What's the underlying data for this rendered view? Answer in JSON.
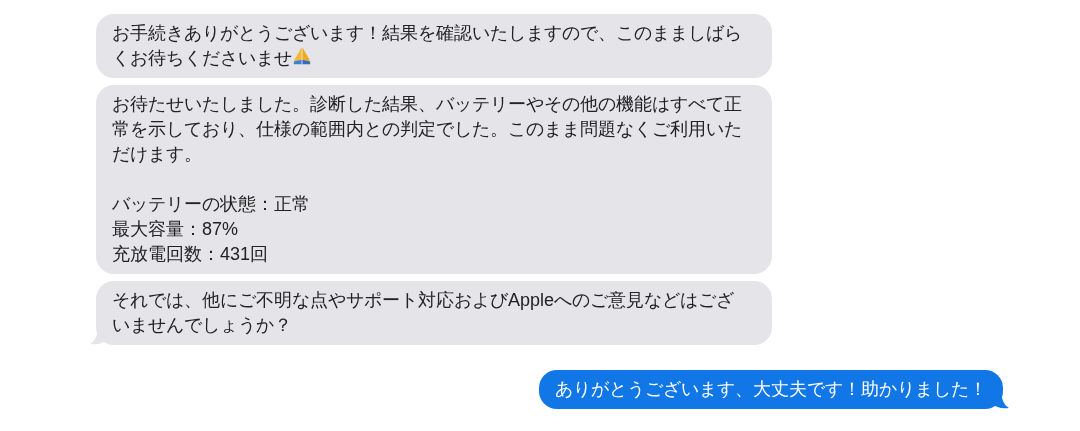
{
  "messages": [
    {
      "kind": "received",
      "tail": false,
      "trailing_icon": true,
      "paragraphs": [
        [
          "お手続きありがとうございます！結果を確認いたしますので、このまましばら",
          "くお待ちくださいませ"
        ]
      ]
    },
    {
      "kind": "received",
      "tail": false,
      "trailing_icon": false,
      "paragraphs": [
        [
          "お待たせいたしました。診断した結果、バッテリーやその他の機能はすべて正",
          "常を示しており、仕様の範囲内との判定でした。このまま問題なくご利用いた",
          "だけます。"
        ],
        [
          "バッテリーの状態：正常",
          "最大容量：87%",
          "充放電回数：431回"
        ]
      ]
    },
    {
      "kind": "received",
      "tail": true,
      "trailing_icon": false,
      "paragraphs": [
        [
          "それでは、他にご不明な点やサポート対応およびAppleへのご意見などはござ",
          "いませんでしょうか？"
        ]
      ]
    },
    {
      "kind": "sent",
      "tail": true,
      "trailing_icon": false,
      "paragraphs": [
        [
          "ありがとうございます、大丈夫です！助かりました！"
        ]
      ]
    }
  ]
}
